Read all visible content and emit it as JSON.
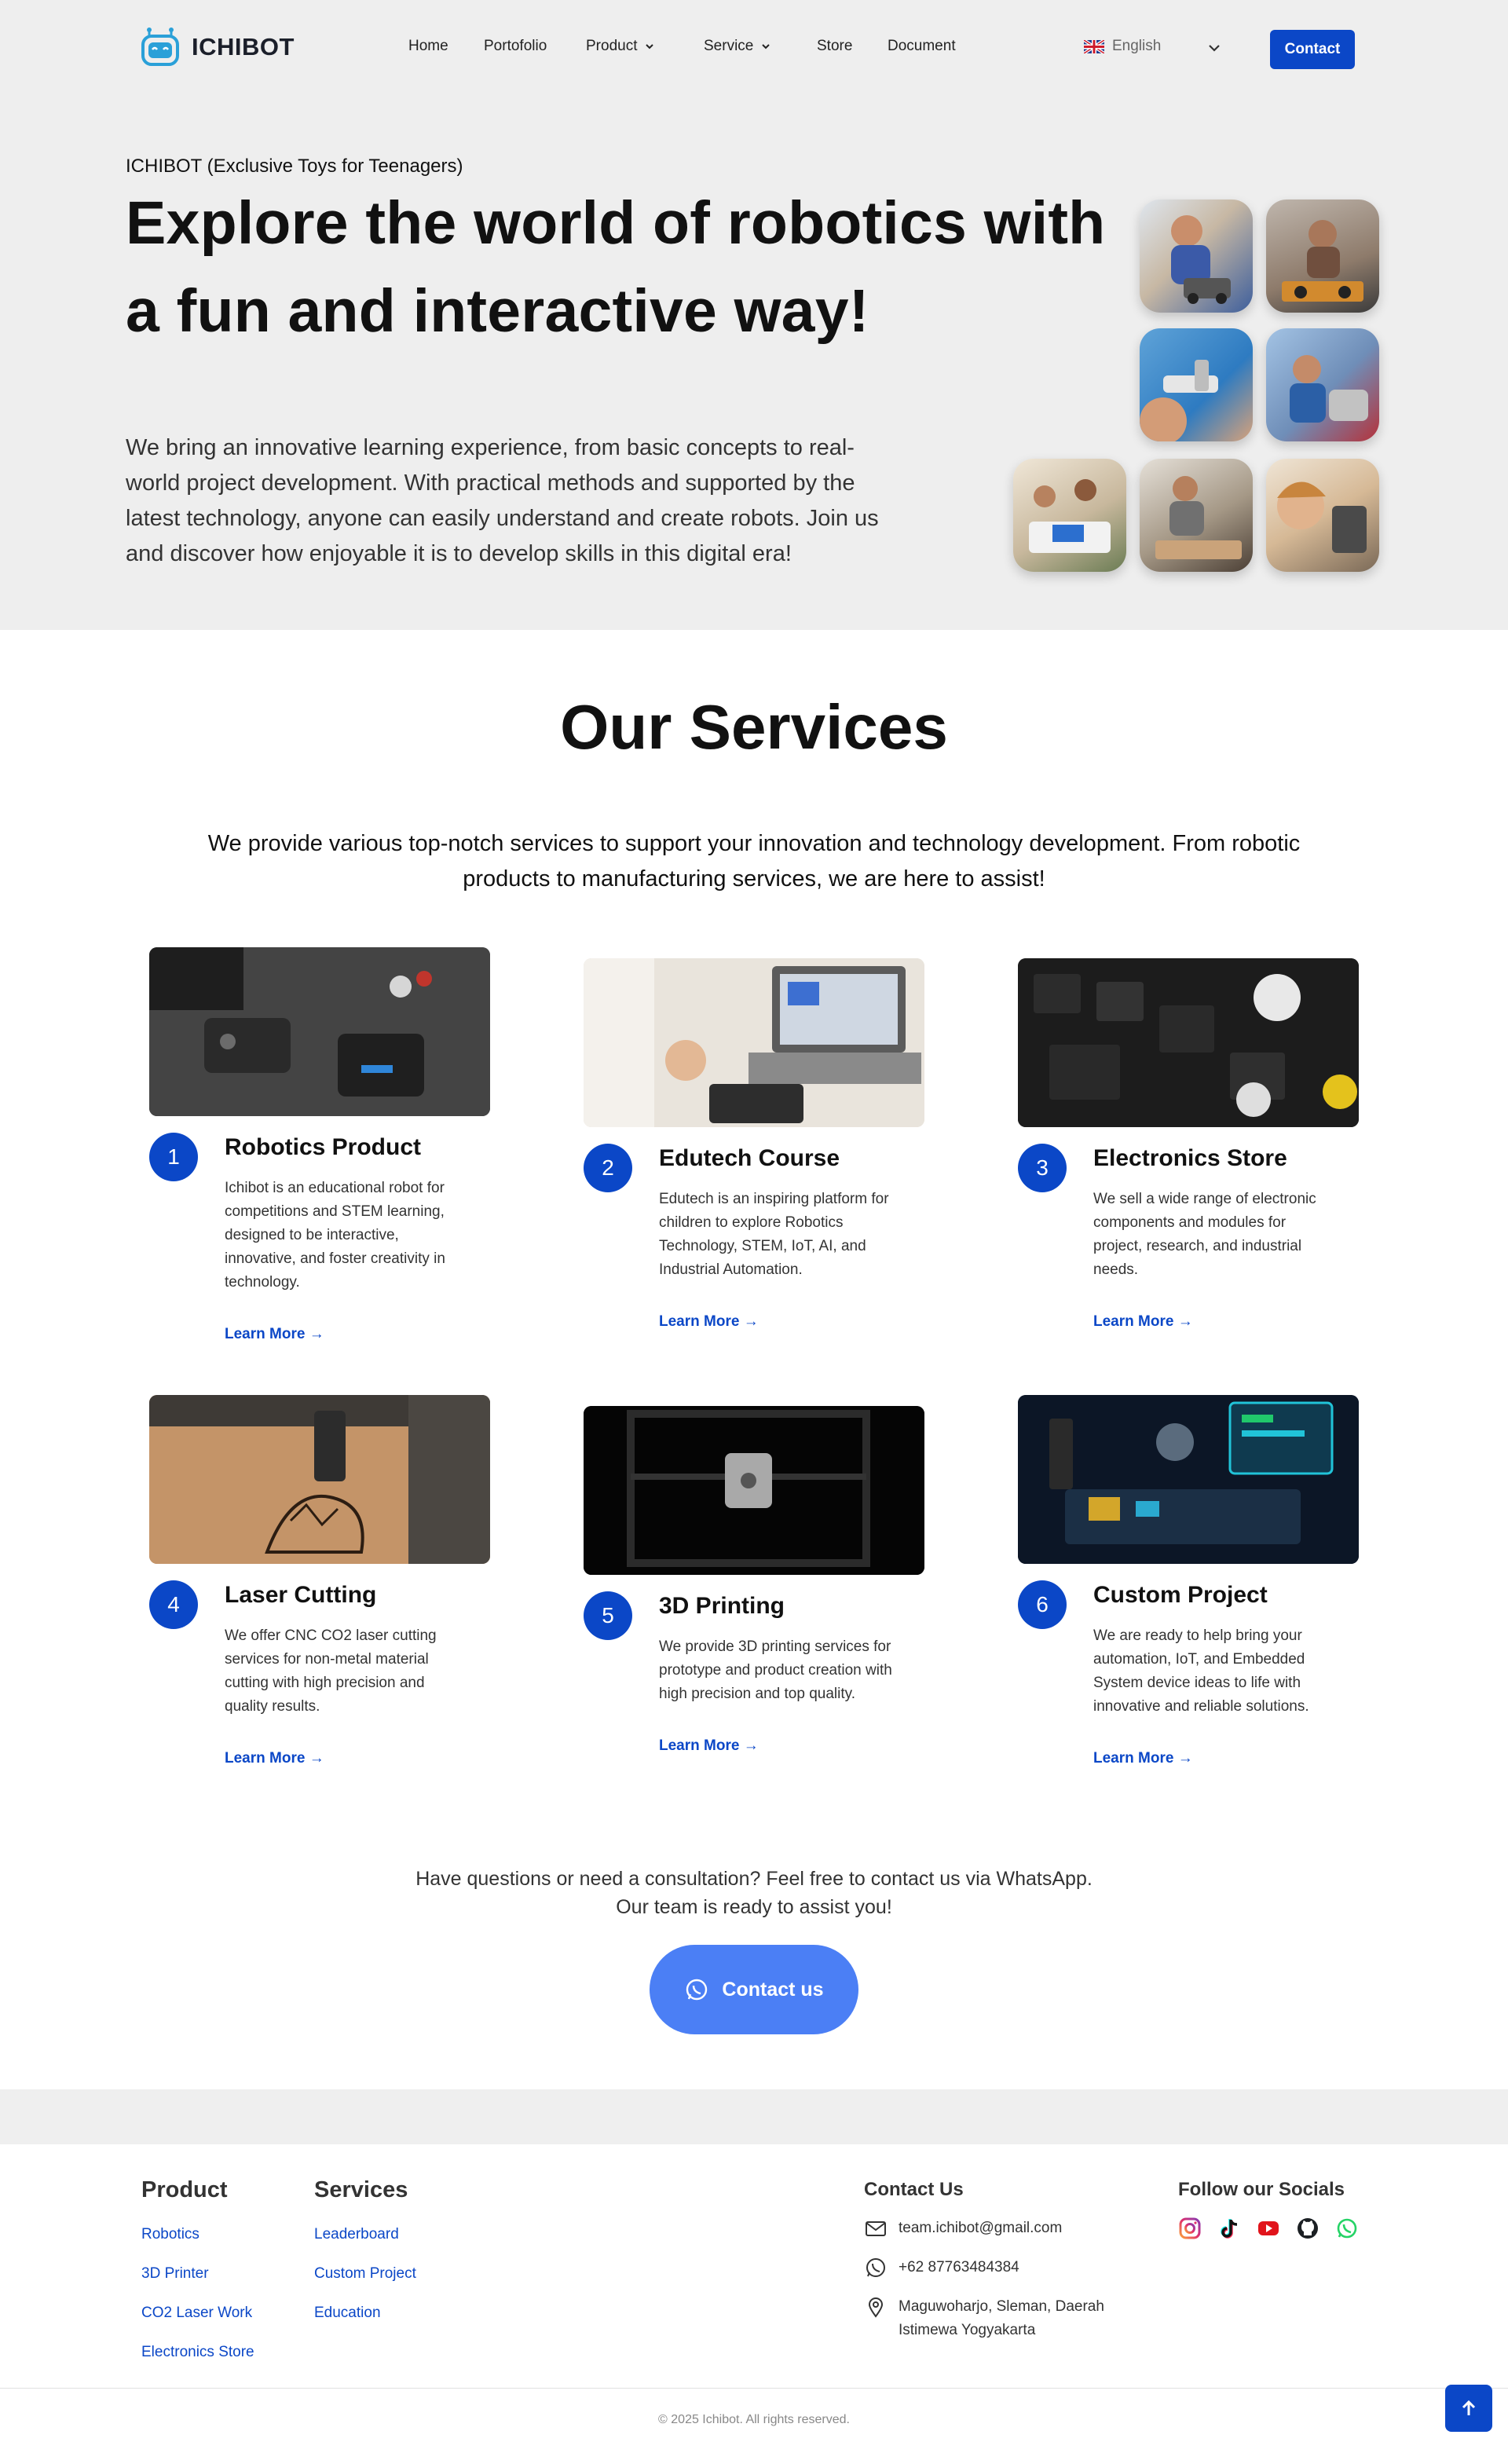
{
  "nav": {
    "brand": "ICHIBOT",
    "items": [
      {
        "label": "Home",
        "dropdown": false
      },
      {
        "label": "Portofolio",
        "dropdown": false
      },
      {
        "label": "Product",
        "dropdown": true
      },
      {
        "label": "Service",
        "dropdown": true
      },
      {
        "label": "Store",
        "dropdown": false
      },
      {
        "label": "Document",
        "dropdown": false
      }
    ],
    "language": "English",
    "contact_label": "Contact"
  },
  "hero": {
    "eyebrow": "ICHIBOT (Exclusive Toys for Teenagers)",
    "title_line1": "Explore the world of robotics with",
    "title_line2": "a fun and interactive way!",
    "desc_lines": [
      "We bring an innovative learning experience, from basic concepts to real-",
      "world project development. With practical methods and supported by the",
      "latest technology, anyone can easily understand and create robots. Join us",
      "and discover how enjoyable it is to develop skills in this digital era!"
    ]
  },
  "services": {
    "title": "Our Services",
    "subtitle_line1": "We provide various top-notch services to support your innovation and technology development. From robotic",
    "subtitle_line2": "products to manufacturing services, we are here to assist!",
    "link_label": "Learn More →",
    "cards": [
      {
        "num": "1",
        "title": "Robotics Product",
        "desc": [
          "Ichibot is an educational robot for",
          "competitions and STEM learning,",
          "designed to be interactive,",
          "innovative, and foster creativity in",
          "technology."
        ]
      },
      {
        "num": "2",
        "title": "Edutech Course",
        "desc": [
          "Edutech is an inspiring platform for",
          "children to explore Robotics",
          "Technology, STEM, IoT, AI, and",
          "Industrial Automation."
        ]
      },
      {
        "num": "3",
        "title": "Electronics Store",
        "desc": [
          "We sell a wide range of electronic",
          "components and modules for",
          "project, research, and industrial",
          "needs."
        ]
      },
      {
        "num": "4",
        "title": "Laser Cutting",
        "desc": [
          "We offer CNC CO2 laser cutting",
          "services for non-metal material",
          "cutting with high precision and",
          "quality results."
        ]
      },
      {
        "num": "5",
        "title": "3D Printing",
        "desc": [
          "We provide 3D printing services for",
          "prototype and product creation with",
          "high precision and top quality."
        ]
      },
      {
        "num": "6",
        "title": "Custom Project",
        "desc": [
          "We are ready to help bring your",
          "automation, IoT, and Embedded",
          "System device ideas to life with",
          "innovative and reliable solutions."
        ]
      }
    ]
  },
  "cta": {
    "line1": "Have questions or need a consultation? Feel free to contact us via WhatsApp.",
    "line2": "Our team is ready to assist you!",
    "button": "Contact us"
  },
  "footer": {
    "product_head": "Product",
    "product_links": [
      "Robotics",
      "3D Printer",
      "CO2 Laser Work",
      "Electronics Store"
    ],
    "services_head": "Services",
    "services_links": [
      "Leaderboard",
      "Custom Project",
      "Education"
    ],
    "contact_head": "Contact Us",
    "email": "team.ichibot@gmail.com",
    "phone": "+62 87763484384",
    "address_line1": "Maguwoharjo, Sleman, Daerah",
    "address_line2": "Istimewa Yogyakarta",
    "socials_head": "Follow our Socials",
    "socials": [
      "instagram-icon",
      "tiktok-icon",
      "youtube-icon",
      "github-icon",
      "whatsapp-icon"
    ],
    "copyright": "© 2025 Ichibot. All rights reserved."
  },
  "colors": {
    "accent": "#0b47c7",
    "cta": "#4b7ff5",
    "hero_bg": "#eeeeee"
  }
}
